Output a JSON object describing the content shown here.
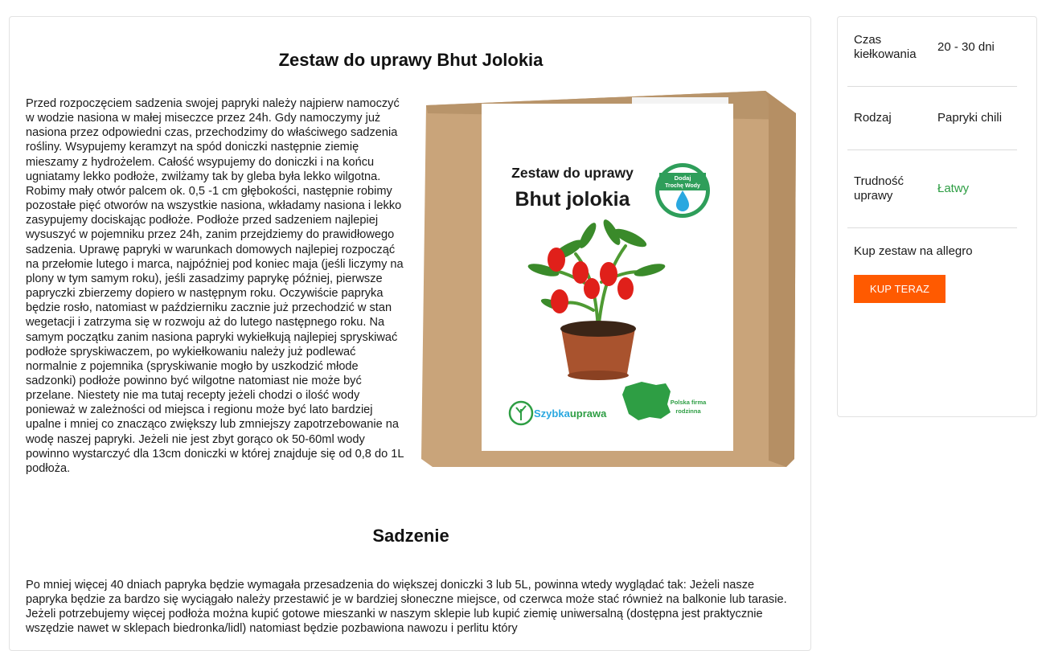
{
  "article": {
    "title": "Zestaw do uprawy Bhut Jolokia",
    "intro": "Przed rozpoczęciem sadzenia swojej papryki należy najpierw namoczyć w wodzie nasiona w małej miseczce przez 24h. Gdy namoczymy już nasiona przez odpowiedni czas, przechodzimy do właściwego sadzenia rośliny. Wsypujemy keramzyt na spód doniczki następnie ziemię mieszamy z hydrożelem. Całość wsypujemy do doniczki i na końcu ugniatamy lekko podłoże, zwilżamy tak by gleba była lekko wilgotna. Robimy mały otwór palcem ok. 0,5 -1 cm głębokości, następnie robimy pozostałe pięć otworów na wszystkie nasiona, wkładamy nasiona i lekko zasypujemy dociskając podłoże. Podłoże przed sadzeniem najlepiej wysuszyć w pojemniku przez 24h, zanim przejdziemy do prawidłowego sadzenia. Uprawę papryki w warunkach domowych najlepiej rozpocząć na przełomie lutego i marca, najpóźniej pod koniec maja (jeśli liczymy na plony w tym samym roku), jeśli zasadzimy paprykę później, pierwsze papryczki zbierzemy dopiero w następnym roku. Oczywiście papryka będzie rosło, natomiast w październiku zacznie już przechodzić w stan wegetacji i zatrzyma się w rozwoju aż do lutego następnego roku. Na samym początku zanim nasiona papryki wykiełkują najlepiej spryskiwać podłoże spryskiwaczem, po wykiełkowaniu należy już podlewać normalnie z pojemnika (spryskiwanie mogło by uszkodzić młode sadzonki) podłoże powinno być wilgotne natomiast nie może być przelane. Niestety nie ma tutaj recepty jeżeli chodzi o ilość wody ponieważ w zależności od miejsca i regionu może być lato bardziej upalne i mniej co znacząco zwiększy lub zmniejszy zapotrzebowanie na wodę naszej papryki. Jeżeli nie jest zbyt gorąco ok 50-60ml wody powinno wystarczyć dla 13cm doniczki w której znajduje się od 0,8 do 1L podłoża.",
    "section_heading": "Sadzenie",
    "section_text": "Po mniej więcej 40 dniach papryka będzie wymagała przesadzenia do większej doniczki 3 lub 5L, powinna wtedy wyglądać tak: Jeżeli nasze papryka będzie za bardzo się wyciągało należy przestawić je w bardziej słoneczne miejsce, od czerwca może stać również na balkonie lub tarasie. Jeżeli potrzebujemy więcej podłoża można kupić gotowe mieszanki w naszym sklepie lub kupić ziemię uniwersalną (dostępna jest praktycznie wszędzie nawet w sklepach biedronka/lidl) natomiast będzie pozbawiona nawozu i perlitu który"
  },
  "product_box": {
    "heading_line1": "Zestaw do uprawy",
    "heading_line2": "Bhut jolokia",
    "badge_line1": "Dodaj",
    "badge_line2": "Trochę Wody",
    "brand": "Szybkauprawa",
    "brand_part1": "Szybka",
    "brand_part2": "uprawa",
    "firm_line1": "Polska firma",
    "firm_line2": "rodzinna"
  },
  "specs": [
    {
      "label": "Czas kiełkowania",
      "value": "20 - 30 dni"
    },
    {
      "label": "Rodzaj",
      "value": "Papryki chili"
    },
    {
      "label": "Trudność uprawy",
      "value": "Łatwy"
    }
  ],
  "purchase": {
    "label": "Kup zestaw na allegro",
    "button_label": "KUP TERAZ"
  },
  "colors": {
    "buy_button": "#ff5a00",
    "easy_difficulty": "#2e9e44",
    "pepper_red": "#e0201a",
    "plant_green": "#3a8a2a",
    "cardboard": "#c9a47a"
  },
  "icons": [
    "water-drop-icon",
    "map-poland-icon",
    "plant-logo-icon"
  ]
}
